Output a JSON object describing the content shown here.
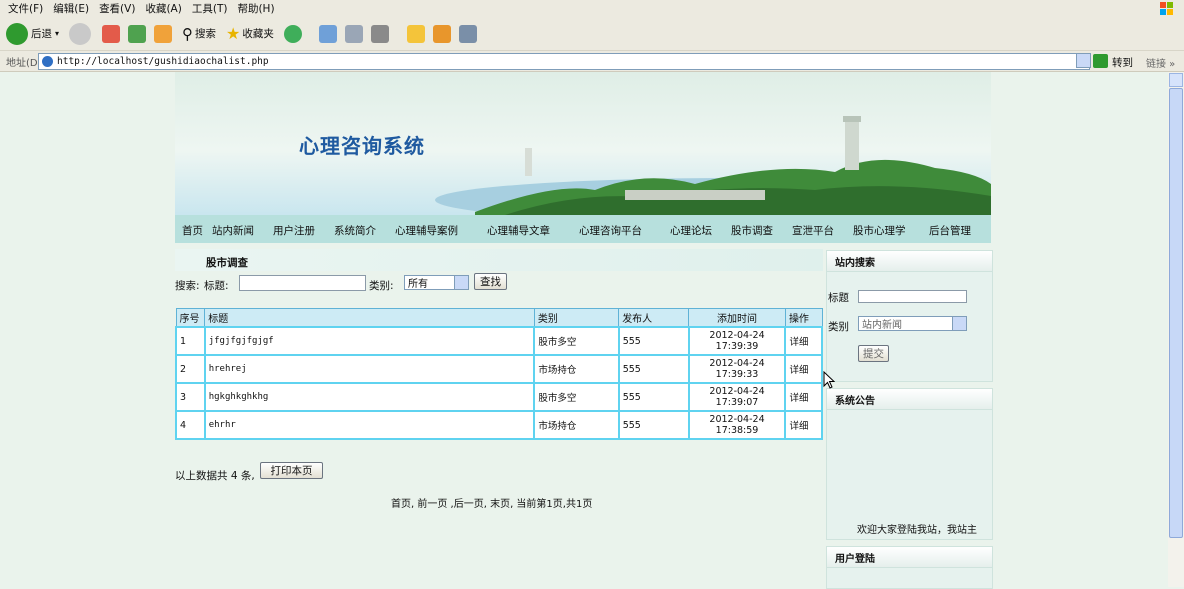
{
  "browser": {
    "menu": [
      "文件(F)",
      "编辑(E)",
      "查看(V)",
      "收藏(A)",
      "工具(T)",
      "帮助(H)"
    ],
    "toolbar": {
      "back": "后退",
      "search": "搜索",
      "favorites": "收藏夹"
    },
    "address_label": "地址(D)",
    "url": "http://localhost/gushidiaochalist.php",
    "go": "转到",
    "links": "链接 »"
  },
  "site": {
    "title": "心理咨询系统"
  },
  "nav": [
    "首页",
    "站内新闻",
    "用户注册",
    "系统简介",
    "心理辅导案例",
    "心理辅导文章",
    "心理咨询平台",
    "心理论坛",
    "股市调查",
    "宣泄平台",
    "股市心理学",
    "后台管理"
  ],
  "page": {
    "title": "股市调查",
    "search": {
      "label_search": "搜索:",
      "label_title": "标题:",
      "title_value": "",
      "label_category": "类别:",
      "category_value": "所有",
      "button": "查找"
    },
    "table": {
      "headers": [
        "序号",
        "标题",
        "类别",
        "发布人",
        "添加时间",
        "操作"
      ],
      "rows": [
        {
          "no": "1",
          "title": "jfgjfgjfgjgf",
          "category": "股市多空",
          "publisher": "555",
          "date": "2012-04-24",
          "time": "17:39:39",
          "action": "详细"
        },
        {
          "no": "2",
          "title": "hrehrej",
          "category": "市场持仓",
          "publisher": "555",
          "date": "2012-04-24",
          "time": "17:39:33",
          "action": "详细"
        },
        {
          "no": "3",
          "title": "hgkghkghkhg",
          "category": "股市多空",
          "publisher": "555",
          "date": "2012-04-24",
          "time": "17:39:07",
          "action": "详细"
        },
        {
          "no": "4",
          "title": "ehrhr",
          "category": "市场持仓",
          "publisher": "555",
          "date": "2012-04-24",
          "time": "17:38:59",
          "action": "详细"
        }
      ]
    },
    "count_text": "以上数据共 4 条,",
    "print_button": "打印本页",
    "pager": "首页, 前一页 ,后一页, 末页, 当前第1页,共1页"
  },
  "sidebar": {
    "search": {
      "head": "站内搜索",
      "label_title": "标题",
      "title_value": "",
      "label_category": "类别",
      "category_value": "站内新闻",
      "submit": "提交"
    },
    "notice": {
      "head": "系统公告",
      "text": "欢迎大家登陆我站，我站主"
    },
    "login": {
      "head": "用户登陆"
    }
  }
}
